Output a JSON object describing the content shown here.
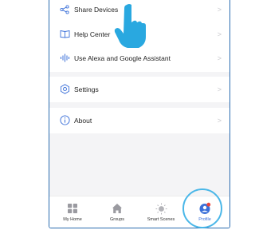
{
  "menu": {
    "share_devices": "Share Devices",
    "help_center": "Help Center",
    "alexa_google": "Use Alexa and Google Assistant",
    "settings": "Settings",
    "about": "About",
    "chevron": ">"
  },
  "tabs": [
    {
      "label": "My Home",
      "icon": "grid-icon"
    },
    {
      "label": "Groups",
      "icon": "house-icon"
    },
    {
      "label": "Smart Scenes",
      "icon": "sun-icon"
    },
    {
      "label": "Profile",
      "icon": "profile-icon",
      "active": true
    }
  ],
  "colors": {
    "accent": "#3a6fd8",
    "highlight_ring": "#4ab7e8",
    "pointer": "#29a8e0",
    "badge": "#e8453c"
  }
}
